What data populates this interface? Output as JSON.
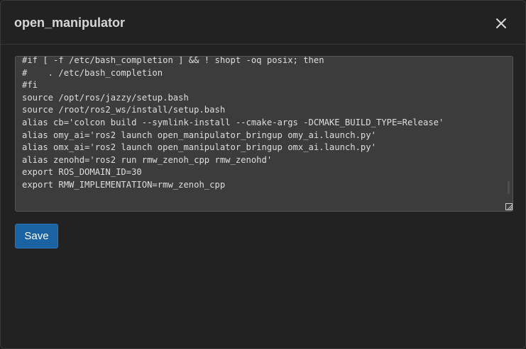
{
  "dialog": {
    "title": "open_manipulator",
    "close_icon": "close-icon",
    "close_label": "Close"
  },
  "editor": {
    "content": "#if [ -f /etc/bash_completion ] && ! shopt -oq posix; then\n#    . /etc/bash_completion\n#fi\nsource /opt/ros/jazzy/setup.bash\nsource /root/ros2_ws/install/setup.bash\nalias cb='colcon build --symlink-install --cmake-args -DCMAKE_BUILD_TYPE=Release'\nalias omy_ai='ros2 launch open_manipulator_bringup omy_ai.launch.py'\nalias omx_ai='ros2 launch open_manipulator_bringup omx_ai.launch.py'\nalias zenohd='ros2 run rmw_zenoh_cpp rmw_zenohd'\nexport ROS_DOMAIN_ID=30\nexport RMW_IMPLEMENTATION=rmw_zenoh_cpp"
  },
  "actions": {
    "save_label": "Save"
  },
  "colors": {
    "background": "#222222",
    "editor_background": "#3c3c3c",
    "primary_button": "#1b62a3",
    "text": "#dedede"
  }
}
